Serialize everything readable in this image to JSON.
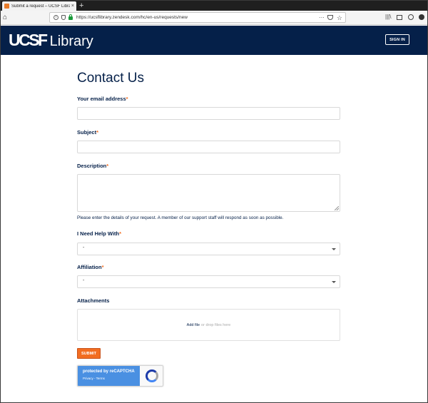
{
  "browser": {
    "tab_title": "Submit a request – UCSF Librar",
    "tab_close": "×",
    "new_tab": "+",
    "url": "https://ucsflibrary.zendesk.com/hc/en-us/requests/new",
    "url_menu": "···",
    "star": "☆",
    "home": "⌂",
    "library": "|||\\"
  },
  "header": {
    "logo_ucsf": "UCSF",
    "logo_library": "Library",
    "signin_label": "SIGN IN",
    "background": "#052049"
  },
  "form": {
    "title": "Contact Us",
    "required_mark": "*",
    "email_label": "Your email address",
    "subject_label": "Subject",
    "description_label": "Description",
    "description_hint": "Please enter the details of your request. A member of our support staff will respond as soon as possible.",
    "help_label": "I Need Help With",
    "help_value": "-",
    "affiliation_label": "Affiliation",
    "affiliation_value": "-",
    "attachments_label": "Attachments",
    "add_file": "Add file",
    "drop_files": "or drop files here",
    "submit_label": "SUBMIT",
    "accent": "#f26d21"
  },
  "captcha": {
    "title": "protected by reCAPTCHA",
    "links": "Privacy - Terms"
  }
}
